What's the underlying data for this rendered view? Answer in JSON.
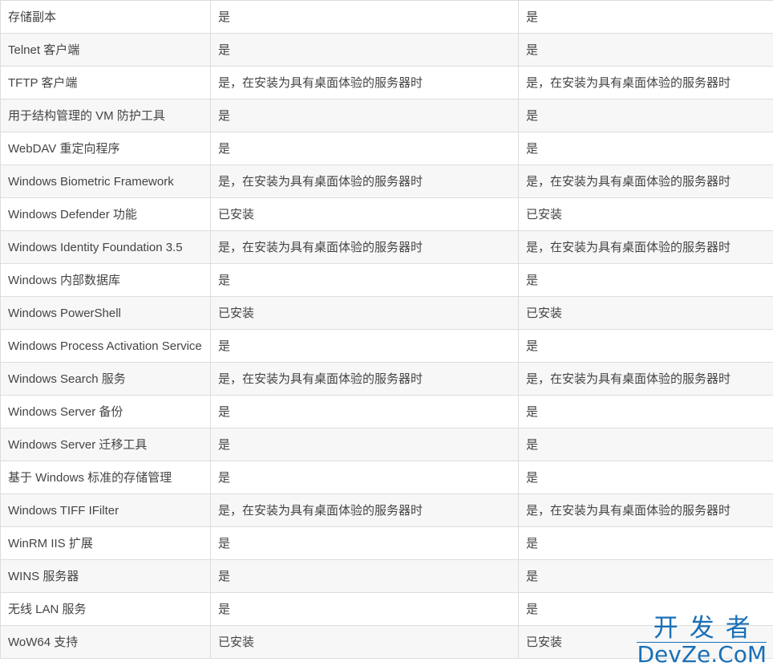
{
  "rows": [
    [
      "存储副本",
      "是",
      "是"
    ],
    [
      "Telnet 客户端",
      "是",
      "是"
    ],
    [
      "TFTP 客户端",
      "是，在安装为具有桌面体验的服务器时",
      "是，在安装为具有桌面体验的服务器时"
    ],
    [
      "用于结构管理的 VM 防护工具",
      "是",
      "是"
    ],
    [
      "WebDAV 重定向程序",
      "是",
      "是"
    ],
    [
      "Windows Biometric Framework",
      "是，在安装为具有桌面体验的服务器时",
      "是，在安装为具有桌面体验的服务器时"
    ],
    [
      "Windows Defender 功能",
      "已安装",
      "已安装"
    ],
    [
      "Windows Identity Foundation 3.5",
      "是，在安装为具有桌面体验的服务器时",
      "是，在安装为具有桌面体验的服务器时"
    ],
    [
      "Windows 内部数据库",
      "是",
      "是"
    ],
    [
      "Windows PowerShell",
      "已安装",
      "已安装"
    ],
    [
      "Windows Process Activation Service",
      "是",
      "是"
    ],
    [
      "Windows Search 服务",
      "是，在安装为具有桌面体验的服务器时",
      "是，在安装为具有桌面体验的服务器时"
    ],
    [
      "Windows Server 备份",
      "是",
      "是"
    ],
    [
      "Windows Server 迁移工具",
      "是",
      "是"
    ],
    [
      "基于 Windows 标准的存储管理",
      "是",
      "是"
    ],
    [
      "Windows TIFF IFilter",
      "是，在安装为具有桌面体验的服务器时",
      "是，在安装为具有桌面体验的服务器时"
    ],
    [
      "WinRM IIS 扩展",
      "是",
      "是"
    ],
    [
      "WINS 服务器",
      "是",
      "是"
    ],
    [
      "无线 LAN 服务",
      "是",
      "是"
    ],
    [
      "WoW64 支持",
      "已安装",
      "已安装"
    ]
  ],
  "watermark": {
    "line1": "开发者",
    "line2": "DevZe.CoM",
    "color": "#1a6fb6"
  }
}
